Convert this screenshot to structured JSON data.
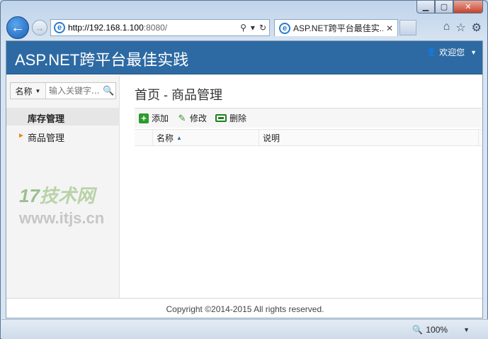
{
  "browser": {
    "address_host": "http://192.168.1.100",
    "address_port": ":8080/",
    "tab_title": "ASP.NET跨平台最佳实...",
    "zoom": "100%"
  },
  "app": {
    "title": "ASP.NET跨平台最佳实践",
    "user_label": "欢迎您"
  },
  "sidebar": {
    "search_type": "名称",
    "search_placeholder": "输入关键字...",
    "group_label": "库存管理",
    "items": [
      {
        "label": "商品管理"
      }
    ]
  },
  "watermark": {
    "logo_number": "17",
    "logo_text": "技术网",
    "url": "www.itjs.cn"
  },
  "main": {
    "breadcrumb": "首页 - 商品管理",
    "toolbar": {
      "add_label": "添加",
      "edit_label": "修改",
      "delete_label": "删除"
    },
    "columns": [
      "名称",
      "说明"
    ]
  },
  "footer": {
    "copyright": "Copyright ©2014-2015 All rights reserved."
  },
  "colors": {
    "header_bg": "#2d6aa3",
    "accent_orange": "#e38a18",
    "toolbar_green": "#2c9b2c"
  }
}
